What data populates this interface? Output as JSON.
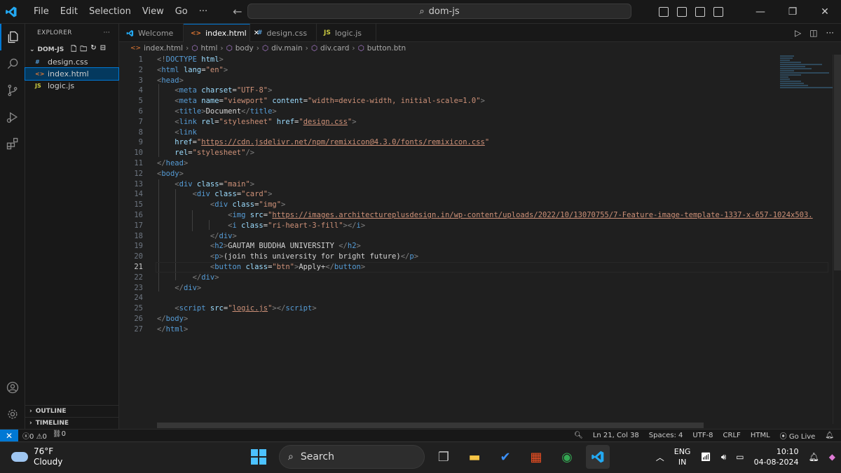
{
  "titlebar": {
    "menu": [
      "File",
      "Edit",
      "Selection",
      "View",
      "Go",
      "···"
    ],
    "command_center": "dom-js"
  },
  "explorer": {
    "header": "EXPLORER",
    "more": "···",
    "folder": "DOM-JS",
    "files": [
      {
        "icon": "#",
        "name": "design.css"
      },
      {
        "icon": "<>",
        "name": "index.html"
      },
      {
        "icon": "JS",
        "name": "logic.js"
      }
    ],
    "outline": "OUTLINE",
    "timeline": "TIMELINE"
  },
  "tabs": [
    {
      "icon": "vscode-icon",
      "label": "Welcome"
    },
    {
      "icon": "<>",
      "label": "index.html",
      "close": "✕"
    },
    {
      "icon": "#",
      "label": "design.css"
    },
    {
      "icon": "JS",
      "label": "logic.js"
    }
  ],
  "breadcrumb": [
    "index.html",
    "html",
    "body",
    "div.main",
    "div.card",
    "button.btn"
  ],
  "editor": {
    "line_numbers": [
      "1",
      "2",
      "3",
      "4",
      "5",
      "6",
      "7",
      "8",
      "9",
      "10",
      "11",
      "12",
      "13",
      "14",
      "15",
      "16",
      "17",
      "18",
      "19",
      "20",
      "21",
      "22",
      "23",
      "24",
      "25",
      "26",
      "27"
    ],
    "current_line": "21"
  },
  "statusbar": {
    "errors": "0",
    "warnings": "0",
    "ports": "0",
    "position": "Ln 21, Col 38",
    "spaces": "Spaces: 4",
    "encoding": "UTF-8",
    "eol": "CRLF",
    "language": "HTML",
    "golive": "Go Live"
  },
  "taskbar": {
    "temp": "76°F",
    "weather": "Cloudy",
    "search": "Search",
    "lang1": "ENG",
    "lang2": "IN",
    "time": "10:10",
    "date": "04-08-2024"
  },
  "colors": {
    "accent": "#0078d4",
    "tag": "#569cd6",
    "attr": "#9cdcfe",
    "string": "#ce9178",
    "bracket": "#808080"
  }
}
